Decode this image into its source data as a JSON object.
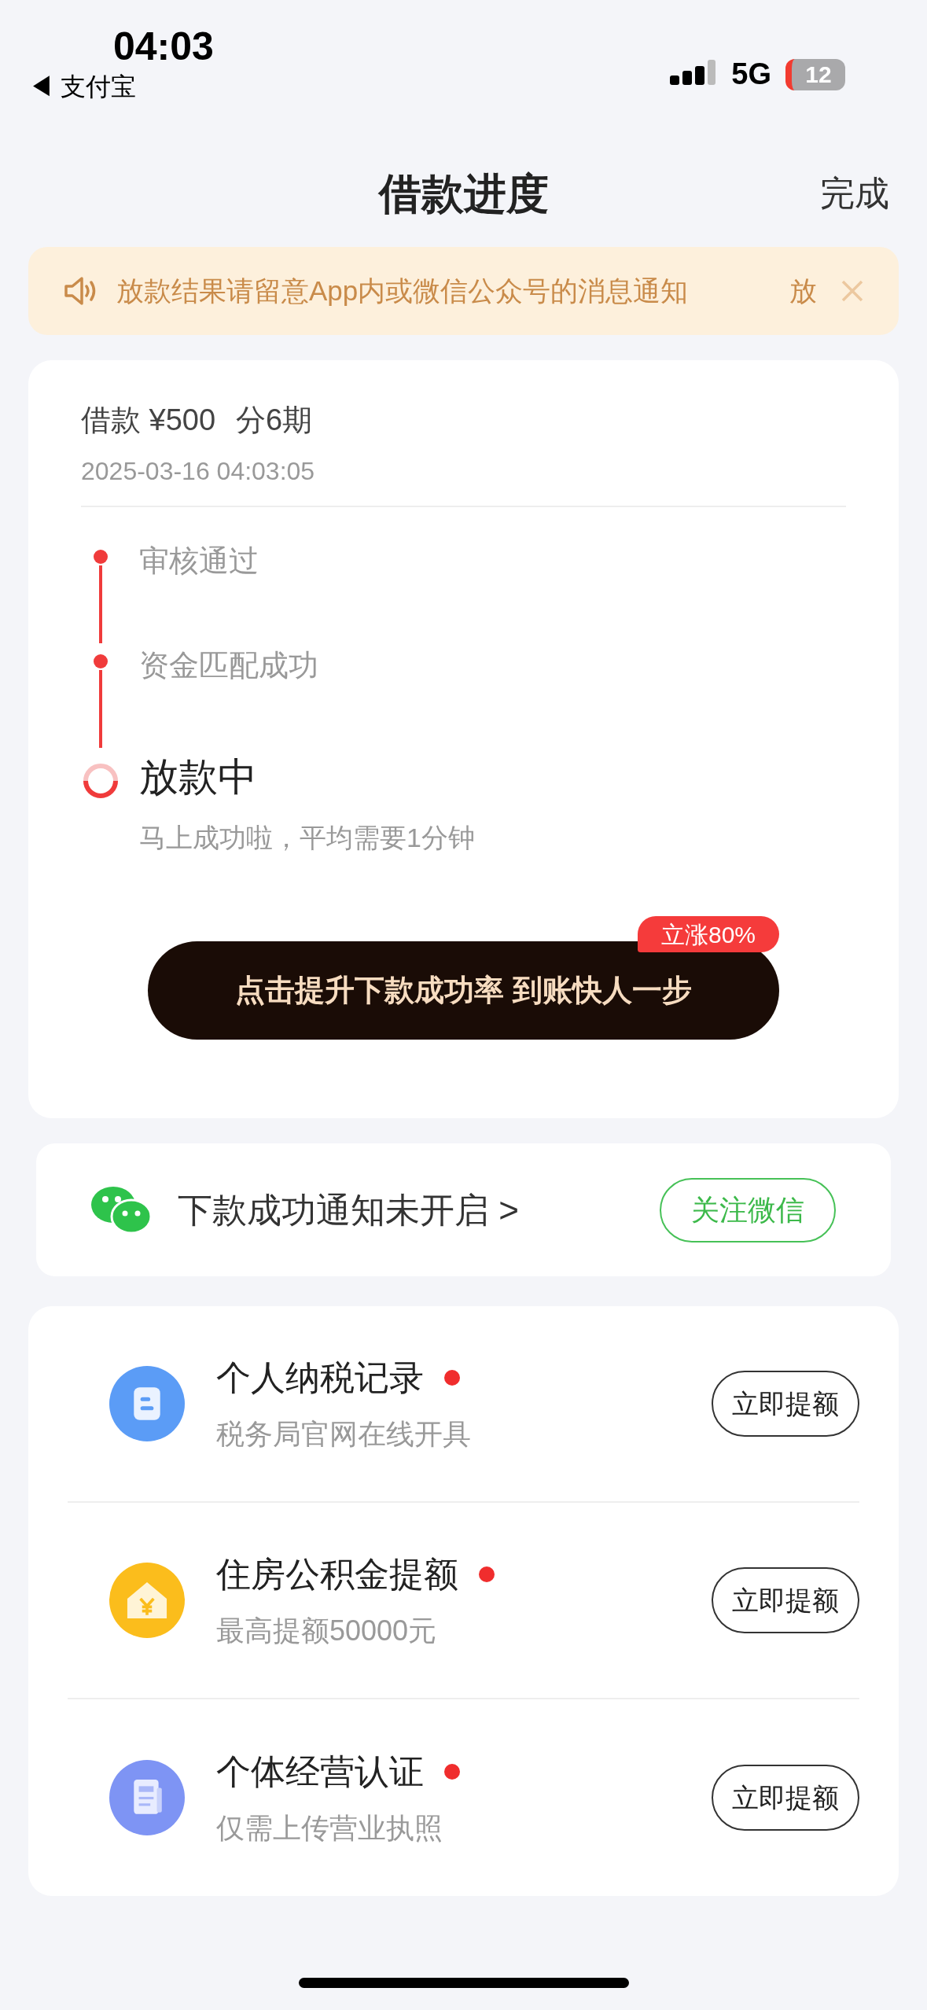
{
  "status_bar": {
    "time": "04:03",
    "back_app": "◀ 支付宝",
    "network": "5G",
    "battery": "12"
  },
  "nav": {
    "title": "借款进度",
    "action": "完成"
  },
  "notice": {
    "text": "放款结果请留意App内或微信公众号的消息通知",
    "overflow": "放"
  },
  "loan": {
    "amount": "借款 ¥500",
    "term": "分6期",
    "time": "2025-03-16 04:03:05",
    "steps": [
      {
        "label": "审核通过",
        "kind": "done"
      },
      {
        "label": "资金匹配成功",
        "kind": "done"
      },
      {
        "label": "放款中",
        "kind": "current",
        "note": "马上成功啦，平均需要1分钟"
      }
    ],
    "cta": {
      "label": "点击提升下款成功率 到账快人一步",
      "badge": "立涨80%"
    }
  },
  "wechat": {
    "text": "下款成功通知未开启 >",
    "button": "关注微信"
  },
  "offers": [
    {
      "title": "个人纳税记录",
      "subtitle": "税务局官网在线开具",
      "button": "立即提额",
      "kind": "document",
      "color": "#5b9cf6",
      "new": true
    },
    {
      "title": "住房公积金提额",
      "subtitle": "最高提额50000元",
      "button": "立即提额",
      "kind": "house",
      "color": "#fbbd1c",
      "new": true
    },
    {
      "title": "个体经营认证",
      "subtitle": "仅需上传营业执照",
      "button": "立即提额",
      "kind": "paper",
      "color": "#7e94f4",
      "new": true
    }
  ]
}
